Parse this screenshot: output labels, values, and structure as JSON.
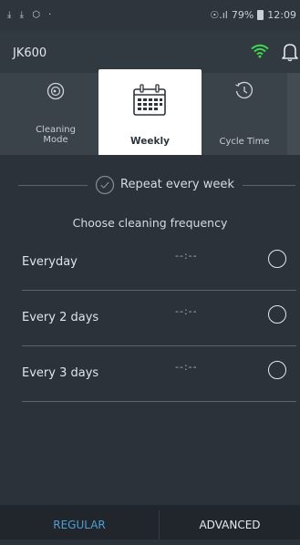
{
  "status_bar": {
    "left_icons": "⤓ ⤓ ⬡ ·",
    "signal": "☉.ıl",
    "battery_percent": "79%",
    "time": "12:09"
  },
  "app_bar": {
    "title": "JK600"
  },
  "mode_tabs": [
    {
      "label": "Cleaning\nMode",
      "icon": "cleaning-mode-icon"
    },
    {
      "label": "Weekly",
      "icon": "calendar-icon",
      "selected": true
    },
    {
      "label": "Cycle Time",
      "icon": "cycle-time-icon"
    }
  ],
  "repeat": {
    "label": "Repeat every week"
  },
  "choose_label": "Choose cleaning frequency",
  "frequencies": [
    {
      "name": "Everyday",
      "time": "--:--"
    },
    {
      "name": "Every 2 days",
      "time": "--:--"
    },
    {
      "name": "Every 3 days",
      "time": "--:--"
    }
  ],
  "bottom_nav": {
    "regular": "REGULAR",
    "advanced": "ADVANCED"
  },
  "colors": {
    "background": "#2b323a",
    "wifi": "#3fd94f",
    "active_nav": "#4f9fd2",
    "selected_tab": "#ffffff"
  }
}
